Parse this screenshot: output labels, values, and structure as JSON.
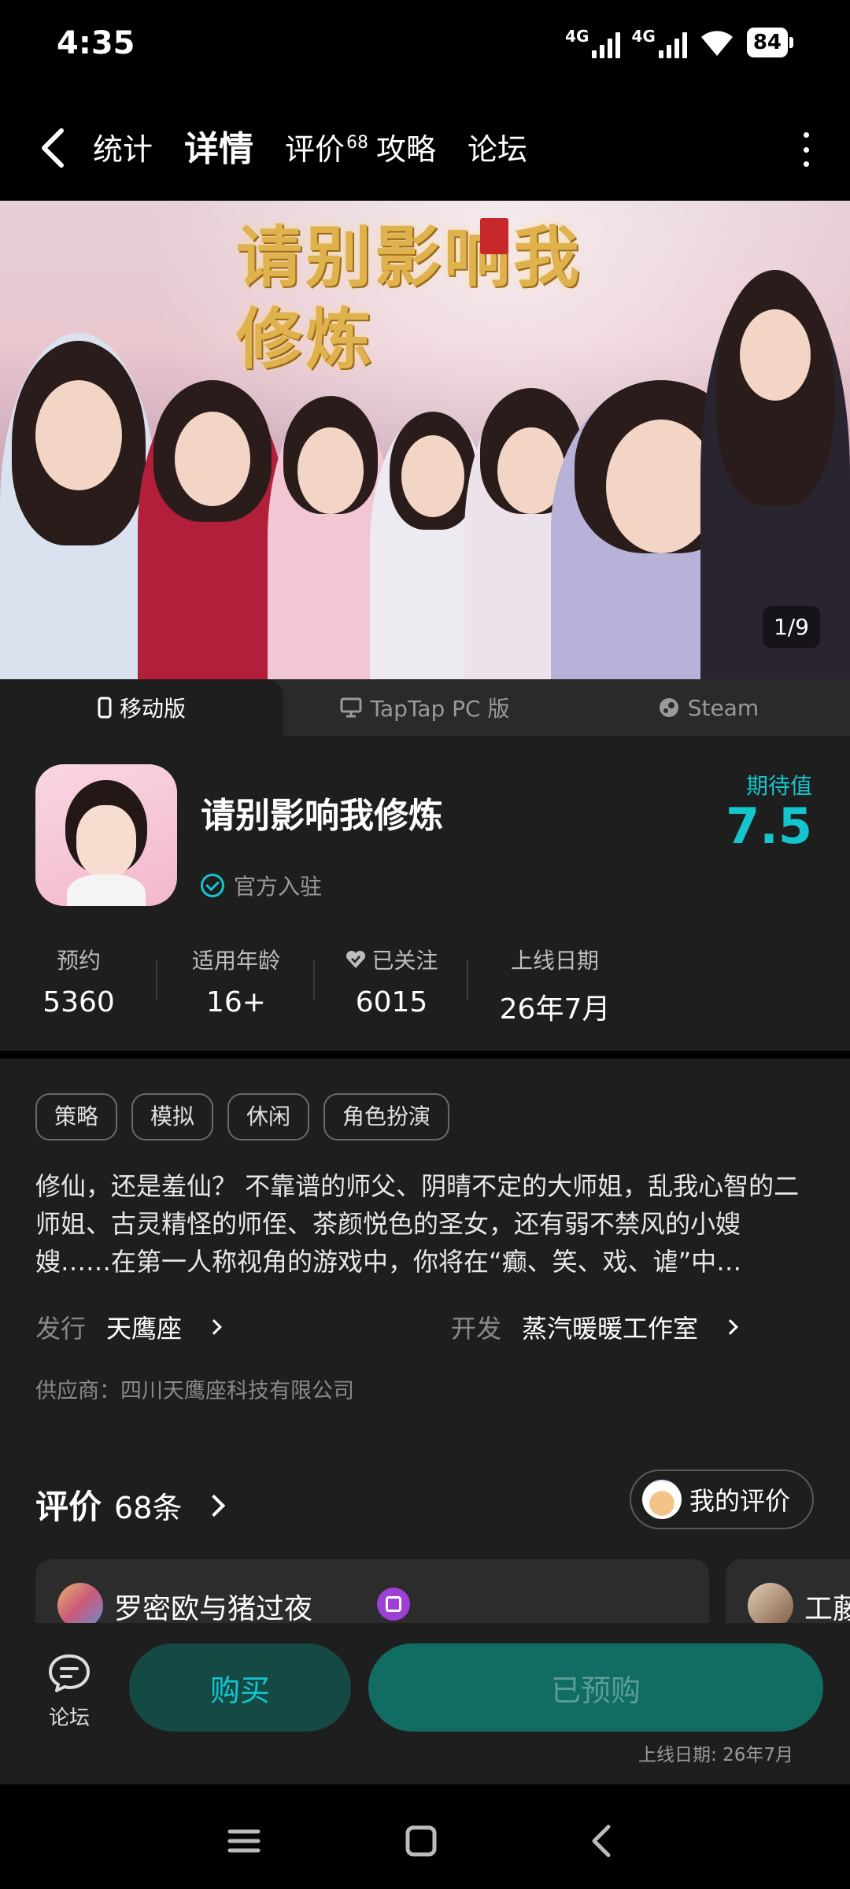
{
  "status_bar": {
    "time": "4:35",
    "network1": "4G",
    "network2": "4G",
    "battery": "84",
    "icons": [
      "signal-icon",
      "signal-icon",
      "wifi-icon",
      "battery-icon"
    ]
  },
  "nav": {
    "tabs": [
      {
        "label": "统计"
      },
      {
        "label": "详情",
        "active": true
      },
      {
        "label": "评价",
        "badge": "68"
      },
      {
        "label": "攻略"
      },
      {
        "label": "论坛"
      }
    ]
  },
  "banner": {
    "title_art": "请别影响我修炼",
    "counter": "1/9"
  },
  "platforms": [
    {
      "label": "移动版",
      "icon": "phone-icon",
      "active": true
    },
    {
      "label": "TapTap PC 版",
      "icon": "monitor-icon"
    },
    {
      "label": "Steam",
      "icon": "steam-icon"
    }
  ],
  "game": {
    "title": "请别影响我修炼",
    "official": "官方入驻",
    "expect_label": "期待值",
    "expect_value": "7.5",
    "stats": [
      {
        "label": "预约",
        "value": "5360"
      },
      {
        "label": "适用年龄",
        "value": "16+"
      },
      {
        "label": "已关注",
        "value": "6015",
        "icon": "heart-icon"
      },
      {
        "label": "上线日期",
        "value": "26年7月"
      }
    ]
  },
  "details": {
    "tags": [
      "策略",
      "模拟",
      "休闲",
      "角色扮演"
    ],
    "description": "修仙，还是羞仙？ 不靠谱的师父、阴晴不定的大师姐，乱我心智的二师姐、古灵精怪的师侄、茶颜悦色的圣女，还有弱不禁风的小嫂嫂……在第一人称视角的游戏中，你将在“癫、笑、戏、谑”中…",
    "publisher_label": "发行",
    "publisher": "天鹰座",
    "developer_label": "开发",
    "developer": "蒸汽暖暖工作室",
    "supplier": "供应商：四川天鹰座科技有限公司"
  },
  "reviews": {
    "title": "评价",
    "count": "68条",
    "my_review": "我的评价",
    "cards": [
      {
        "name": "罗密欧与猪过夜"
      },
      {
        "name": "工藤"
      }
    ]
  },
  "actions": {
    "forum": "论坛",
    "buy": "购买",
    "reserved": "已预购",
    "release_note": "上线日期: 26年7月"
  },
  "colors": {
    "accent": "#15c5ce",
    "background": "#1e1e1e",
    "reserved_button": "#116c61",
    "buy_button": "#144a43"
  }
}
